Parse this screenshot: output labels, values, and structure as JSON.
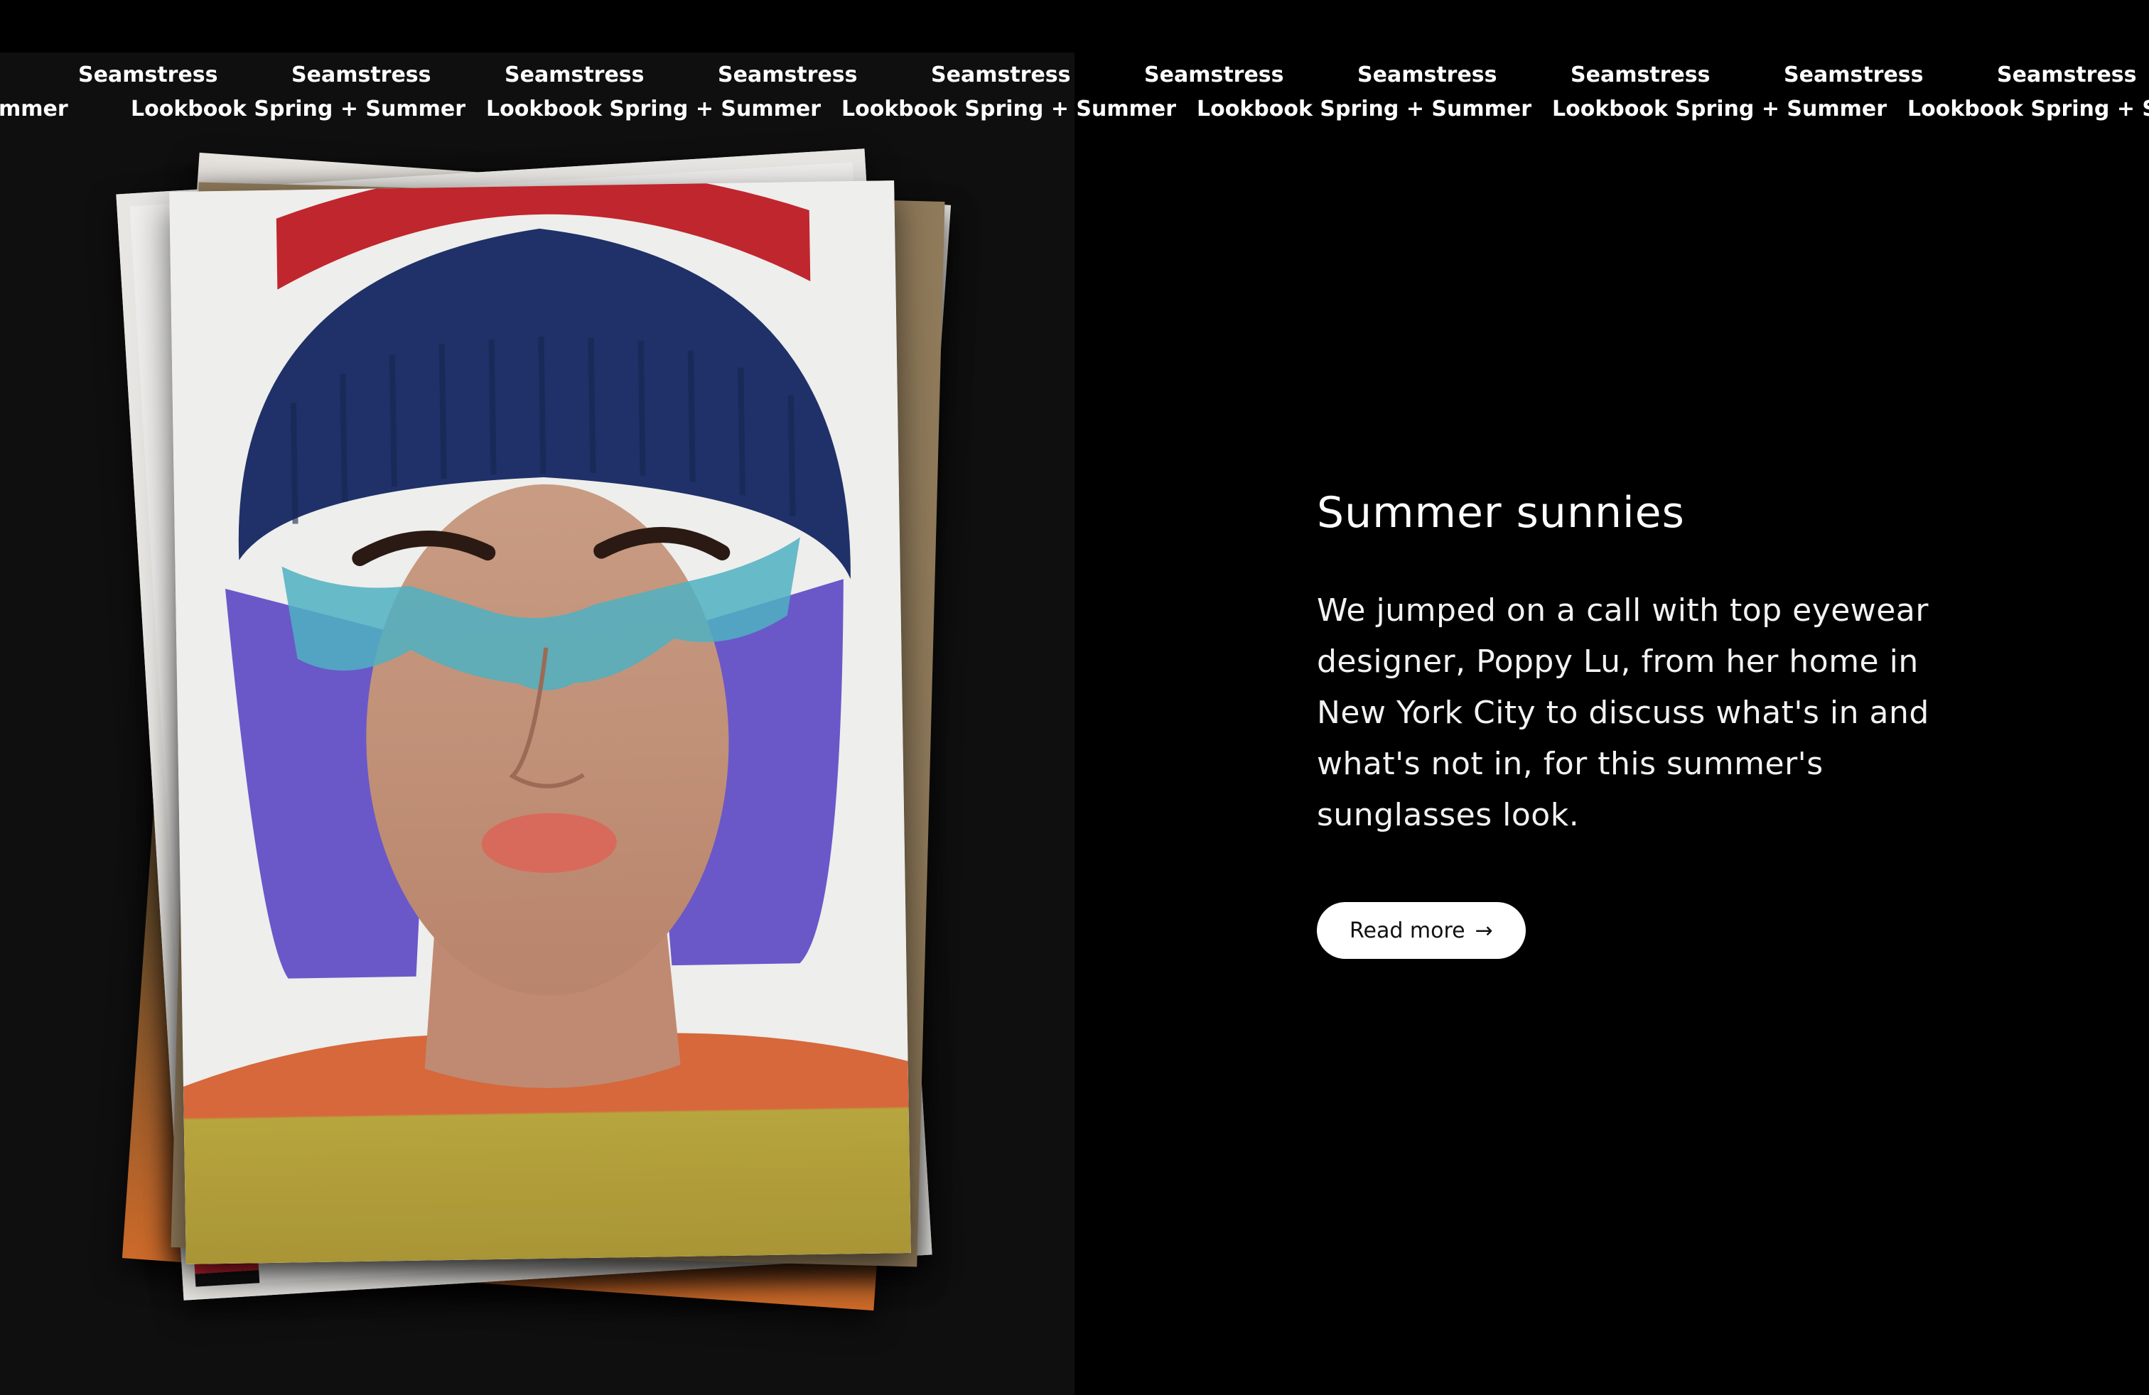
{
  "marquee": {
    "brand": "Seamstress",
    "collection": "Lookbook Spring + Summer",
    "collection_partial_left": "mmer",
    "collection_partial_right": "Lookbook Spring + Sum"
  },
  "article": {
    "title": "Summer sunnies",
    "body": "We jumped on a call with top eyewear designer, Poppy Lu, from her home in New York City to discuss what's in and what's not in, for this summer's sunglasses look.",
    "body_lines": [
      "We jumped on a call with top eyewear",
      "designer, Poppy Lu, from her home in",
      "New York City to discuss what's in and",
      "what's not in, for this summer's",
      "sunglasses look."
    ],
    "cta_label": "Read more",
    "cta_icon": "arrow-right-icon"
  },
  "colors": {
    "page_background": "#000000",
    "left_panel_background": "#0f0f0f",
    "button_background": "#ffffff",
    "button_text": "#111111"
  }
}
